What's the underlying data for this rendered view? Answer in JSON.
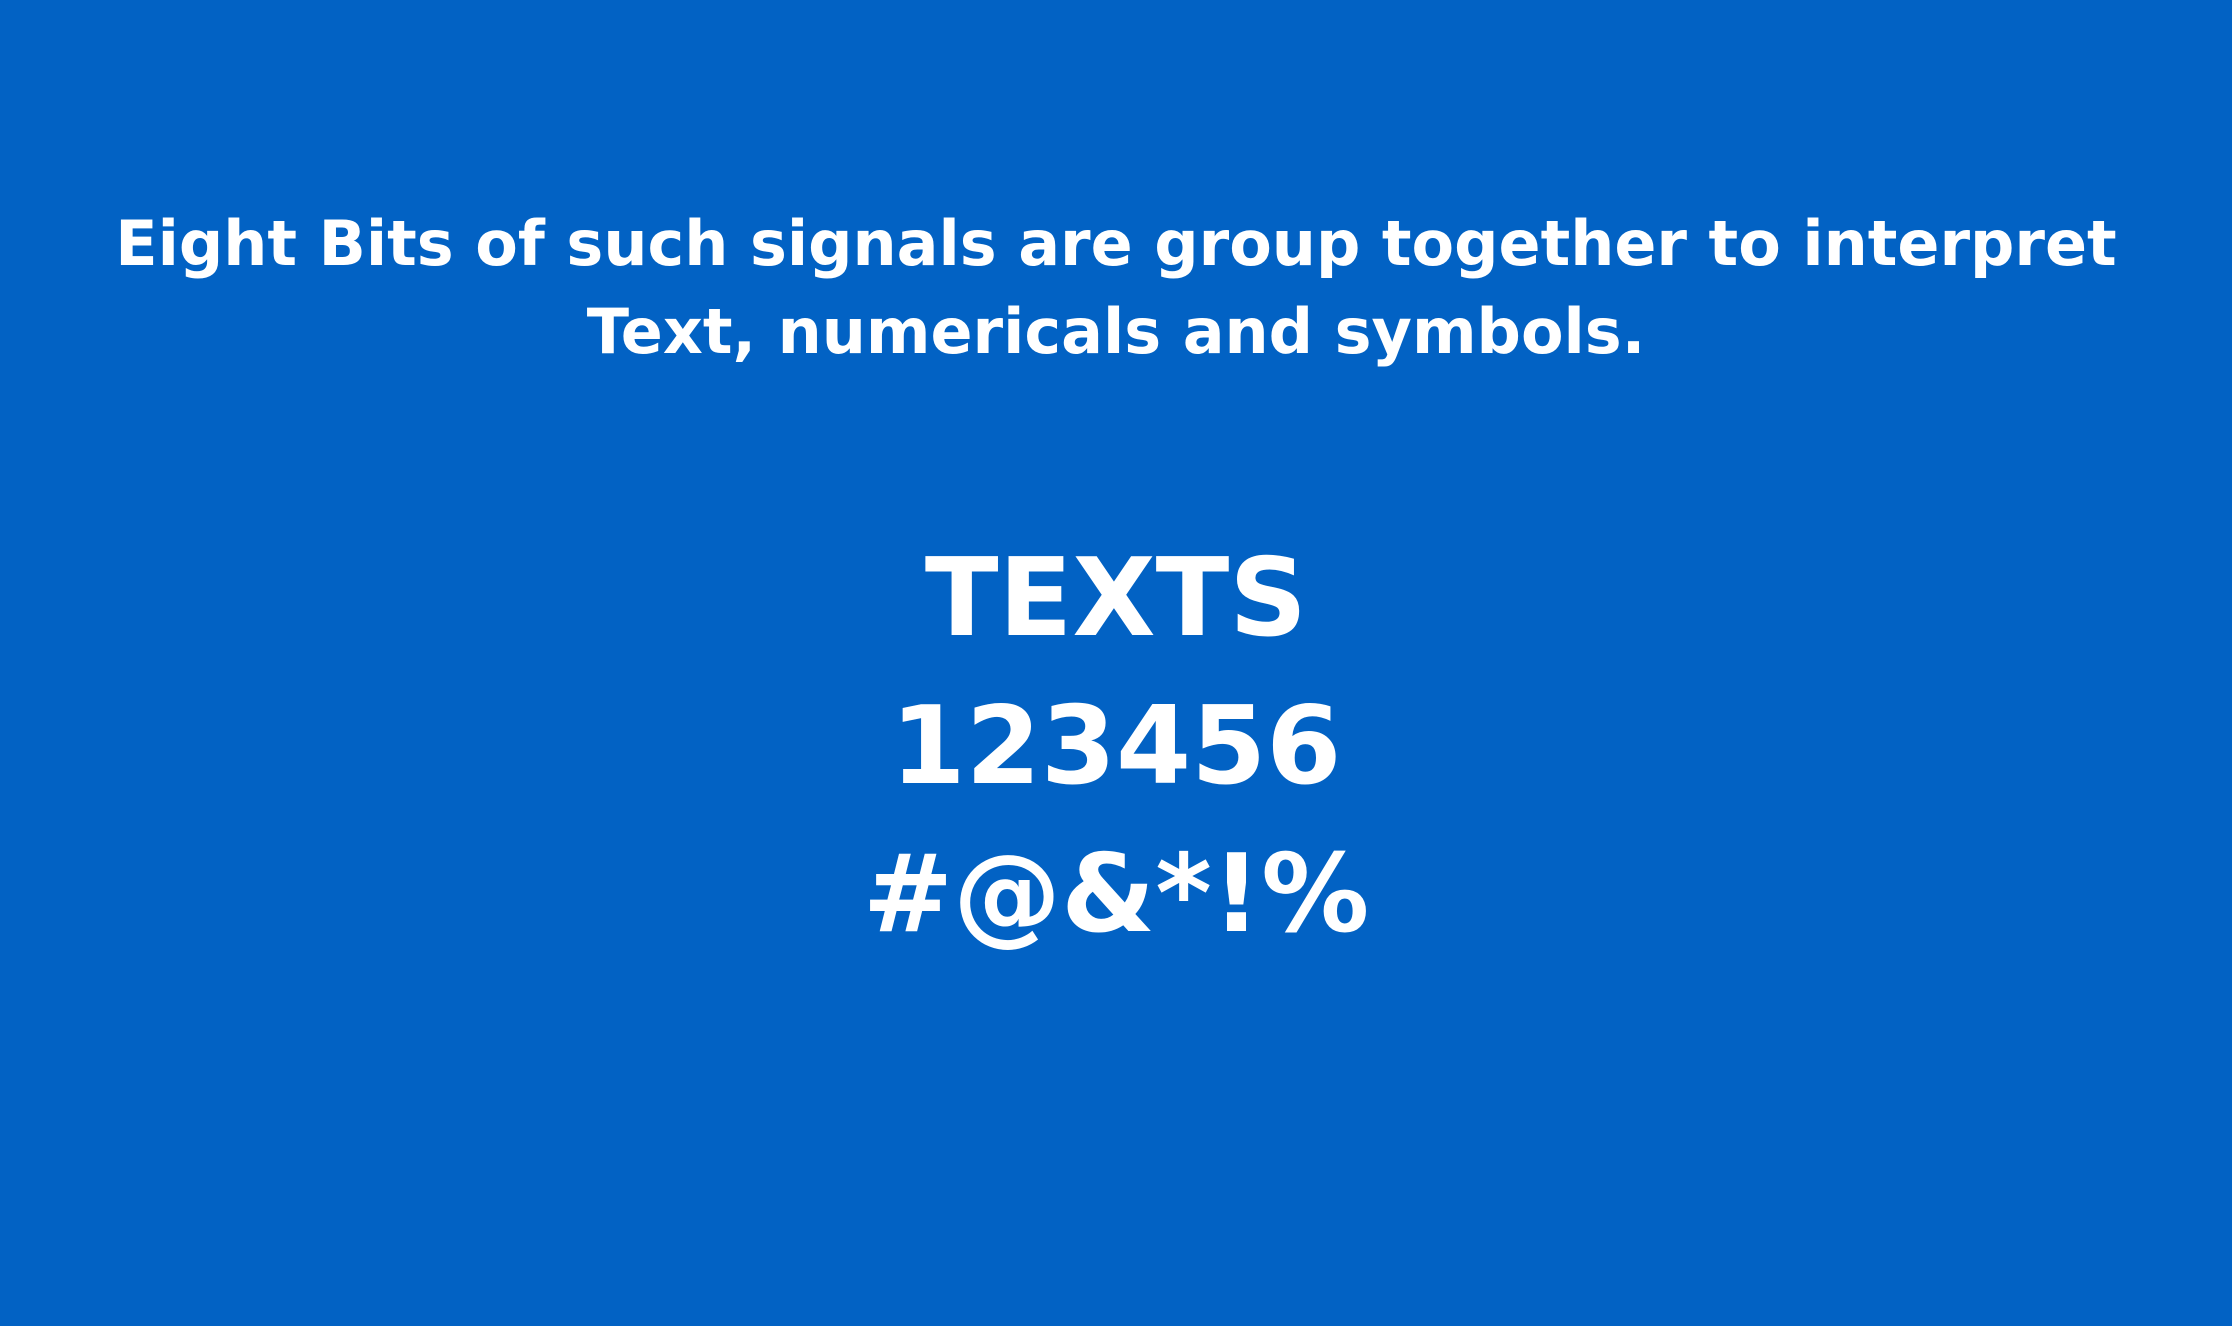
{
  "slide": {
    "background_color": "#0262C4",
    "text_color": "#FFFFFF",
    "intro_lines": [
      "Eight Bits of such signals are group together to interpret",
      "Text, numericals and symbols."
    ],
    "examples": {
      "texts": "TEXTS",
      "numbers": "123456",
      "symbols": "#@&*!%"
    }
  }
}
